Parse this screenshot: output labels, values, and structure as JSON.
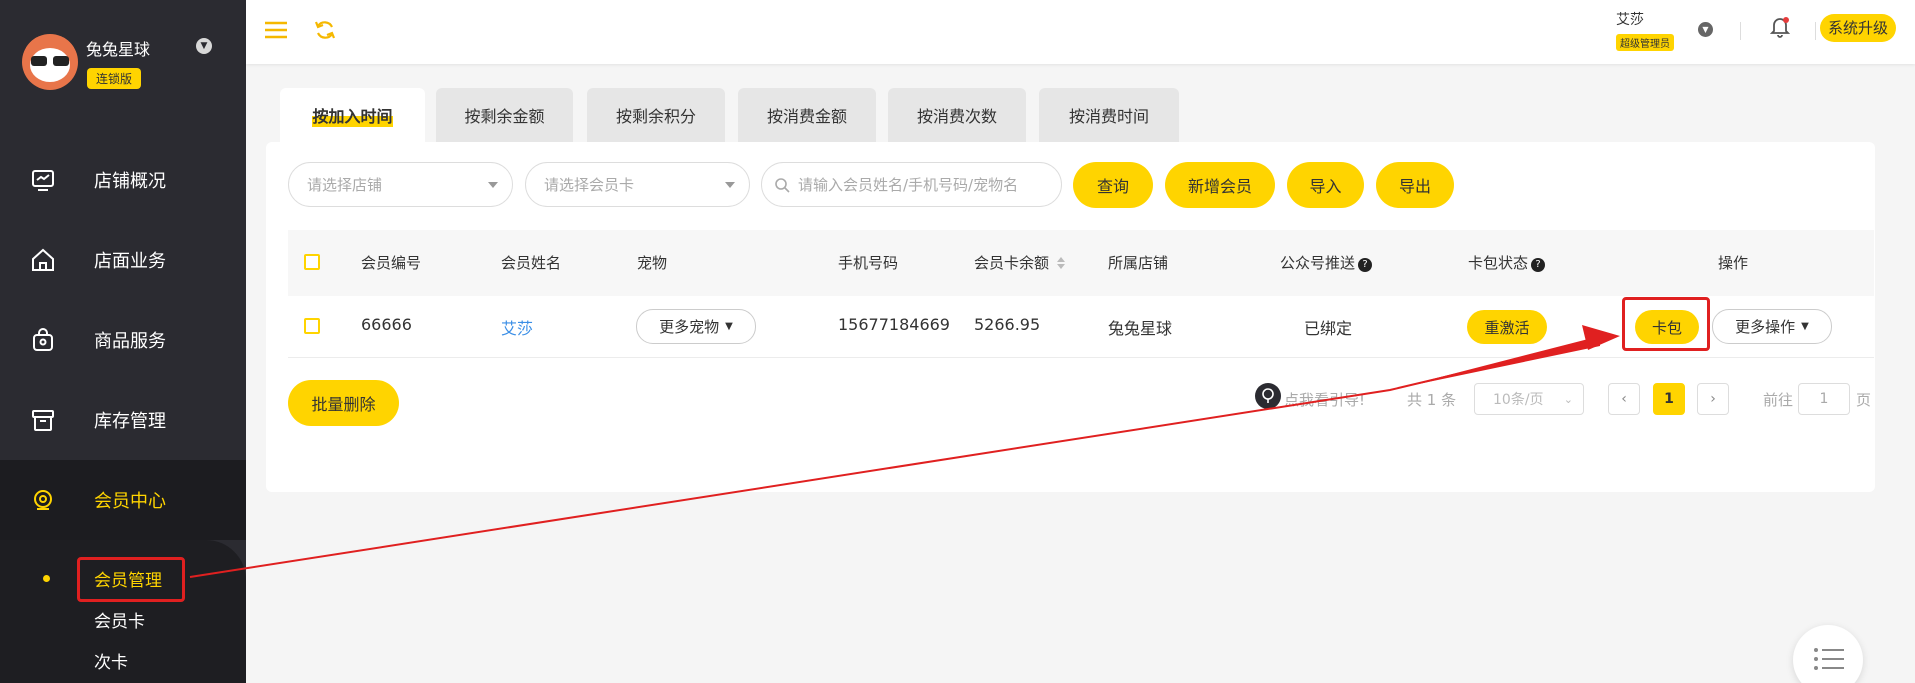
{
  "sidebar": {
    "store_name": "兔兔星球",
    "edition": "连锁版",
    "nav": [
      "店铺概况",
      "店面业务",
      "商品服务",
      "库存管理",
      "会员中心"
    ],
    "sub": [
      "会员管理",
      "会员卡",
      "次卡"
    ]
  },
  "topbar": {
    "user_name": "艾莎",
    "user_role": "超级管理员",
    "upgrade_label": "系统升级"
  },
  "tabs": [
    "按加入时间",
    "按剩余金额",
    "按剩余积分",
    "按消费金额",
    "按消费次数",
    "按消费时间"
  ],
  "filters": {
    "store_placeholder": "请选择店铺",
    "card_placeholder": "请选择会员卡",
    "search_placeholder": "请输入会员姓名/手机号码/宠物名"
  },
  "buttons": {
    "query": "查询",
    "add_member": "新增会员",
    "import": "导入",
    "export": "导出",
    "batch_delete": "批量删除"
  },
  "table": {
    "headers": [
      "会员编号",
      "会员姓名",
      "宠物",
      "手机号码",
      "会员卡余额",
      "所属店铺",
      "公众号推送",
      "卡包状态",
      "操作"
    ],
    "row": {
      "id": "66666",
      "name": "艾莎",
      "pets": "更多宠物",
      "phone": "15677184669",
      "balance": "5266.95",
      "store": "兔兔星球",
      "wechat": "已绑定",
      "card_status": "重激活",
      "card_pack": "卡包",
      "more_ops": "更多操作"
    }
  },
  "pagination": {
    "guide": "点我看引导!",
    "total": "共 1 条",
    "page_size": "10条/页",
    "current_page": "1",
    "goto_label": "前往",
    "goto_value": "1",
    "page_unit": "页"
  },
  "colors": {
    "accent": "#ffd400",
    "sidebar_bg": "#2b2b31",
    "annotation_red": "#e02020",
    "link_blue": "#3a8ee6"
  }
}
